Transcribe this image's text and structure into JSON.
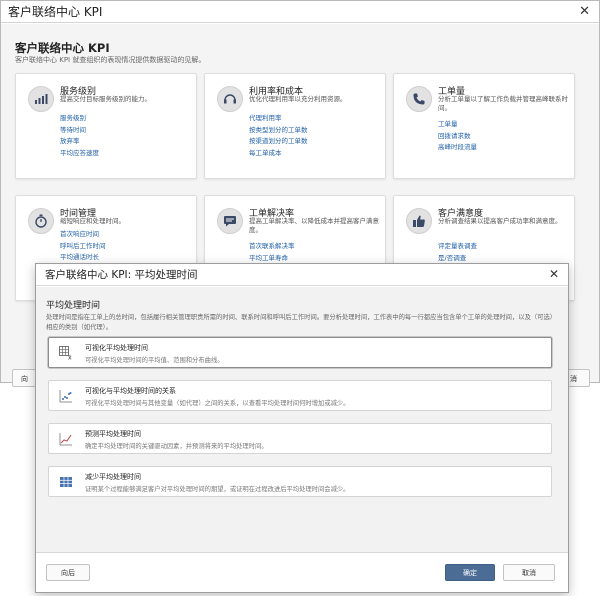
{
  "background": {
    "window_title": "客户联络中心 KPI",
    "close_glyph": "✕",
    "heading": "客户联络中心 KPI",
    "description": "客户联络中心 KPI 就查组织的表现情况提供数据驱动的见解。",
    "cards": [
      {
        "title": "服务级别",
        "icon": "bar-chart-icon",
        "description": "提高交付目标服务级别的能力。",
        "links": [
          "服务级别",
          "等待时间",
          "放弃率",
          "平均应答速度"
        ]
      },
      {
        "title": "利用率和成本",
        "icon": "headset-icon",
        "description": "优化代理利用率以充分利用资源。",
        "links": [
          "代理利用率",
          "按类型划分的工单数",
          "按渠道划分的工单数",
          "每工单成本"
        ]
      },
      {
        "title": "工单量",
        "icon": "phone-icon",
        "description": "分析工单量以了解工作负载并管理高峰联系时间。",
        "links": [
          "工单量",
          "回拨请求数",
          "高峰时段流量"
        ]
      },
      {
        "title": "时间管理",
        "icon": "stopwatch-icon",
        "description": "缩短响应和处理时间。",
        "links": [
          "首次响应时间",
          "呼叫后工作时间",
          "平均通话时长"
        ]
      },
      {
        "title": "工单解决率",
        "icon": "chat-icon",
        "description": "提高工单解决率、以降低成本并提高客户满意度。",
        "links": [
          "首次联系解决率",
          "平均工单寿命"
        ]
      },
      {
        "title": "客户满意度",
        "icon": "thumbs-up-icon",
        "description": "分析调查结果以提高客户成功率和满意度。",
        "links": [
          "评定量表调查",
          "是/否调查"
        ]
      }
    ],
    "footer_left_label": "向",
    "footer_right_label": "消"
  },
  "dialog": {
    "title": "客户联络中心 KPI: 平均处理时间",
    "close_glyph": "✕",
    "heading": "平均处理时间",
    "description": "处理时间是指在工单上的总时间，包括履行相关管理职责所需的时间、联系时间和呼叫后工作时间。要分析处理时间，工作表中的每一行都应当包含单个工单的处理时间，以及（可选）相应的类别（如代理）。",
    "options": [
      {
        "title": "可视化平均处理时间",
        "description": "可视化平均处理时间的平均值、范围和分布曲线。",
        "icon": "table-calc-icon"
      },
      {
        "title": "可视化与平均处理时间的关系",
        "description": "可视化平均处理时间与其他变量（如代理）之间的关系，以查看平均处理时间何时增加或减少。",
        "icon": "scatter-plot-icon"
      },
      {
        "title": "预测平均处理时间",
        "description": "确定平均处理时间的关键驱动因素，并预测将来的平均处理时间。",
        "icon": "trend-chart-icon"
      },
      {
        "title": "减少平均处理时间",
        "description": "证明某个过程能够满足客户对平均处理时间的期望，或证明在过程改进后平均处理时间会减少。",
        "icon": "grid-table-icon"
      }
    ],
    "buttons": {
      "back": "向后",
      "ok": "确定",
      "cancel": "取消"
    }
  },
  "colors": {
    "link": "#1f5fa8",
    "primary_button": "#4a6c95",
    "panel_background": "#f4f4f4"
  }
}
